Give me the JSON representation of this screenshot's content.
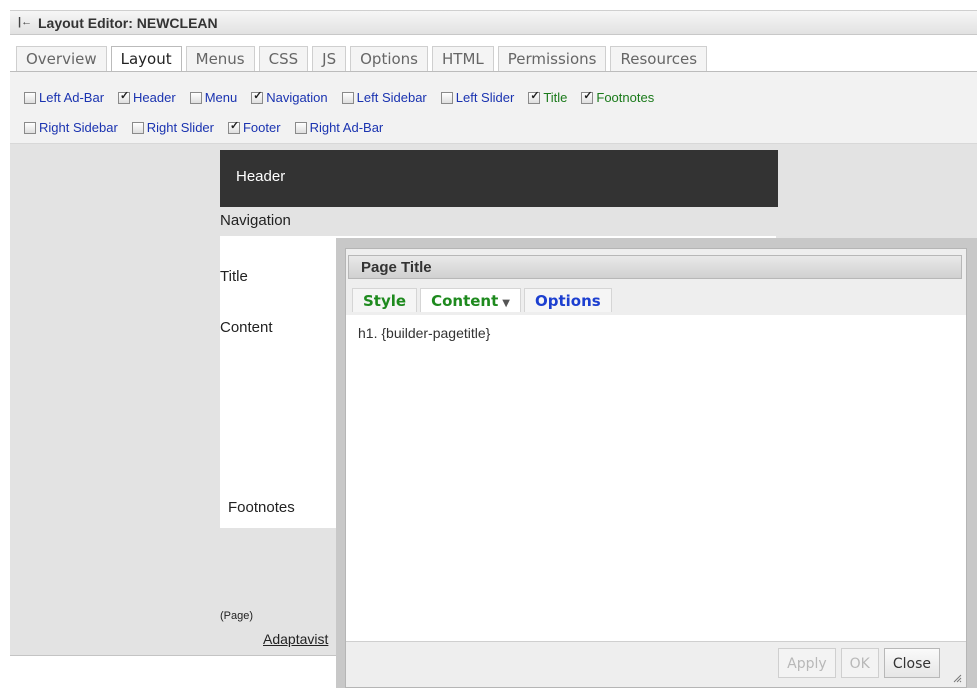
{
  "window": {
    "title": "Layout Editor: NEWCLEAN",
    "collapse_icon": "collapse-left-icon"
  },
  "tabs": [
    {
      "label": "Overview",
      "active": false
    },
    {
      "label": "Layout",
      "active": true
    },
    {
      "label": "Menus",
      "active": false
    },
    {
      "label": "CSS",
      "active": false
    },
    {
      "label": "JS",
      "active": false
    },
    {
      "label": "Options",
      "active": false
    },
    {
      "label": "HTML",
      "active": false
    },
    {
      "label": "Permissions",
      "active": false
    },
    {
      "label": "Resources",
      "active": false
    }
  ],
  "panels": {
    "row1": [
      {
        "label": "Left Ad-Bar",
        "checked": false,
        "color": "#1a33b0"
      },
      {
        "label": "Header",
        "checked": true,
        "color": "#1a33b0"
      },
      {
        "label": "Menu",
        "checked": false,
        "color": "#1a33b0"
      },
      {
        "label": "Navigation",
        "checked": true,
        "color": "#1a33b0"
      },
      {
        "label": "Left Sidebar",
        "checked": false,
        "color": "#1a33b0"
      },
      {
        "label": "Left Slider",
        "checked": false,
        "color": "#1a33b0"
      },
      {
        "label": "Title",
        "checked": true,
        "color": "#1a7a1a"
      },
      {
        "label": "Footnotes",
        "checked": true,
        "color": "#1a7a1a"
      }
    ],
    "row2": [
      {
        "label": "Right Sidebar",
        "checked": false,
        "color": "#1a33b0"
      },
      {
        "label": "Right Slider",
        "checked": false,
        "color": "#1a33b0"
      },
      {
        "label": "Footer",
        "checked": true,
        "color": "#1a33b0"
      },
      {
        "label": "Right Ad-Bar",
        "checked": false,
        "color": "#1a33b0"
      }
    ]
  },
  "preview": {
    "header": "Header",
    "navigation": "Navigation",
    "title": "Title",
    "content": "Content",
    "footnotes": "Footnotes",
    "page": "(Page)",
    "footer_link": "Adaptavist"
  },
  "dialog": {
    "title": "Page Title",
    "tabs": [
      {
        "label": "Style",
        "color": "green"
      },
      {
        "label": "Content",
        "color": "green",
        "active": true,
        "has_dropdown": true
      },
      {
        "label": "Options",
        "color": "blue"
      }
    ],
    "content_text": "h1. {builder-pagetitle}",
    "buttons": [
      {
        "label": "Apply",
        "enabled": false
      },
      {
        "label": "OK",
        "enabled": false
      },
      {
        "label": "Close",
        "enabled": true
      }
    ]
  },
  "colors": {
    "header_bg": "#333333",
    "link_blue": "#1a33b0",
    "tab_green": "#1e8a1e",
    "tab_blue": "#1c3fd0"
  }
}
